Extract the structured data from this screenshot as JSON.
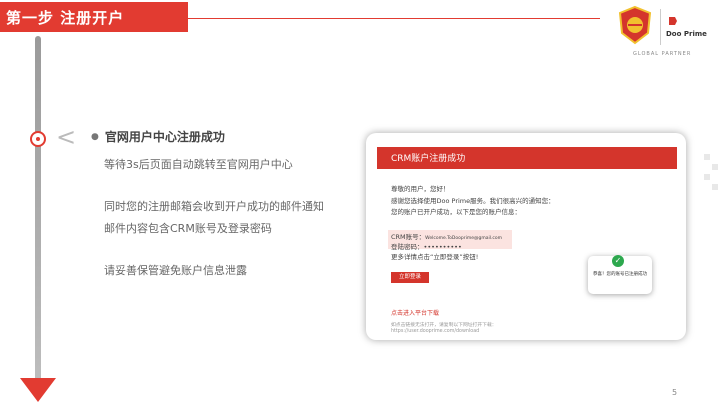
{
  "header": {
    "title": "第一步  注册开户"
  },
  "brand": {
    "accent": "#e23b31",
    "dp_name": "Doo Prime",
    "partner": "GLOBAL PARTNER"
  },
  "step": {
    "title": "官网用户中心注册成功",
    "lines": [
      "等待3s后页面自动跳转至官网用户中心",
      "同时您的注册邮箱会收到开户成功的邮件通知",
      "邮件内容包含CRM账号及登录密码",
      "请妥善保管避免账户信息泄露"
    ]
  },
  "email": {
    "header": "CRM账户注册成功",
    "greeting": "尊敬的用户，您好！",
    "body1": "感谢您选择使用Doo Prime服务。我们很高兴的通知您：",
    "body2": "您的账户已开户成功，以下是您的账户信息：",
    "crm_label": "CRM账号：",
    "crm_value": "Welcome.ToDooprime@gmail.com",
    "pw_label": "登陆密码：",
    "pw_value": "••••••••••",
    "more": "更多详情点击“立即登录”按钮!",
    "login_button": "立即登录",
    "download_link": "点击进入平台下载",
    "fallback": "如点击链接无法打开，请复制以下网址打开下载：",
    "url": "https://user.dooprime.com/download"
  },
  "toast": {
    "text": "恭喜！您的账号已注册成功"
  },
  "page": {
    "number": "5"
  }
}
